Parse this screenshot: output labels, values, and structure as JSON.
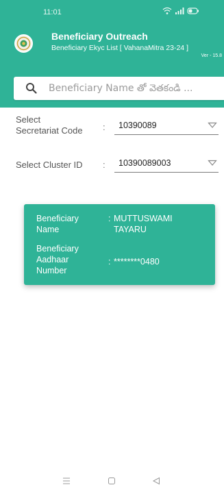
{
  "status_bar": {
    "time": "11:01"
  },
  "header": {
    "title": "Beneficiary Outreach",
    "subtitle": "Beneficiary Ekyc List [ VahanaMitra 23-24 ]",
    "version": "Ver - 15.8"
  },
  "search": {
    "placeholder": "Beneficiary Name తో వెతకండి ..."
  },
  "filters": {
    "secretariat": {
      "label_line1": "Select",
      "label_line2": "Secretariat Code",
      "value": "10390089"
    },
    "cluster": {
      "label": "Select Cluster ID",
      "value": "10390089003"
    },
    "colon": ":"
  },
  "beneficiary": {
    "name_label_line1": "Beneficiary",
    "name_label_line2": "Name",
    "name_line1": "MUTTUSWAMI",
    "name_line2": "TAYARU",
    "aadhaar_label_line1": "Beneficiary",
    "aadhaar_label_line2": "Aadhaar",
    "aadhaar_label_line3": "Number",
    "aadhaar_value": "********0480",
    "colon": ":"
  },
  "colors": {
    "primary": "#2fb397"
  },
  "icons": [
    "wifi-icon",
    "signal-icon",
    "battery-icon",
    "app-logo",
    "search-icon",
    "dropdown-arrow-icon",
    "menu-nav-icon",
    "home-nav-icon",
    "back-nav-icon"
  ]
}
